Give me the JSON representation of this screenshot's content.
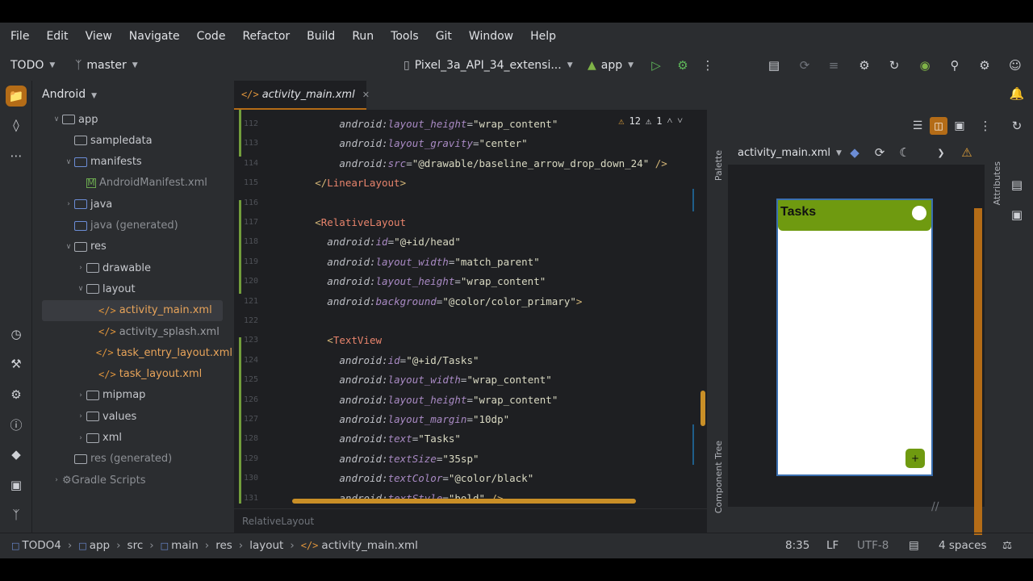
{
  "menu": [
    "File",
    "Edit",
    "View",
    "Navigate",
    "Code",
    "Refactor",
    "Build",
    "Run",
    "Tools",
    "Git",
    "Window",
    "Help"
  ],
  "toolbar": {
    "project": "TODO",
    "branch": "master",
    "device": "Pixel_3a_API_34_extensi...",
    "run_config": "app"
  },
  "project_panel": {
    "view": "Android",
    "items": [
      {
        "label": "app",
        "indent": 1,
        "arrow": "down",
        "icon": "folder"
      },
      {
        "label": "sampledata",
        "indent": 2,
        "arrow": "",
        "icon": "folder"
      },
      {
        "label": "manifests",
        "indent": 2,
        "arrow": "down",
        "icon": "folder-blue"
      },
      {
        "label": "AndroidManifest.xml",
        "indent": 3,
        "arrow": "",
        "icon": "manifest"
      },
      {
        "label": "java",
        "indent": 2,
        "arrow": "right",
        "icon": "folder-blue"
      },
      {
        "label": "java (generated)",
        "indent": 2,
        "arrow": "",
        "icon": "folder-blue"
      },
      {
        "label": "res",
        "indent": 2,
        "arrow": "down",
        "icon": "folder"
      },
      {
        "label": "drawable",
        "indent": 3,
        "arrow": "right",
        "icon": "folder"
      },
      {
        "label": "layout",
        "indent": 3,
        "arrow": "down",
        "icon": "folder"
      },
      {
        "label": "activity_main.xml",
        "indent": 4,
        "arrow": "",
        "icon": "xml",
        "selected": true
      },
      {
        "label": "activity_splash.xml",
        "indent": 4,
        "arrow": "",
        "icon": "xml"
      },
      {
        "label": "task_entry_layout.xml",
        "indent": 4,
        "arrow": "",
        "icon": "xml"
      },
      {
        "label": "task_layout.xml",
        "indent": 4,
        "arrow": "",
        "icon": "xml"
      },
      {
        "label": "mipmap",
        "indent": 3,
        "arrow": "right",
        "icon": "folder"
      },
      {
        "label": "values",
        "indent": 3,
        "arrow": "right",
        "icon": "folder"
      },
      {
        "label": "xml",
        "indent": 3,
        "arrow": "right",
        "icon": "folder"
      },
      {
        "label": "res (generated)",
        "indent": 2,
        "arrow": "",
        "icon": "folder"
      },
      {
        "label": "Gradle Scripts",
        "indent": 1,
        "arrow": "right",
        "icon": "gradle"
      }
    ]
  },
  "editor": {
    "tab": "activity_main.xml",
    "inspections": {
      "warnings": "12",
      "weak": "1"
    },
    "lines": [
      {
        "n": "112",
        "i": 8,
        "kind": "attr",
        "ns": "android",
        "name": "layout_height",
        "value": "\"wrap_content\""
      },
      {
        "n": "113",
        "i": 8,
        "kind": "attr",
        "ns": "android",
        "name": "layout_gravity",
        "value": "\"center\""
      },
      {
        "n": "114",
        "i": 8,
        "kind": "attr",
        "ns": "android",
        "name": "src",
        "value": "\"@drawable/baseline_arrow_drop_down_24\"",
        "tail": " />"
      },
      {
        "n": "115",
        "i": 4,
        "kind": "close",
        "tag": "LinearLayout"
      },
      {
        "n": "116",
        "i": 0,
        "kind": "blank"
      },
      {
        "n": "117",
        "i": 4,
        "kind": "open",
        "tag": "RelativeLayout"
      },
      {
        "n": "118",
        "i": 6,
        "kind": "attr",
        "ns": "android",
        "name": "id",
        "value": "\"@+id/head\""
      },
      {
        "n": "119",
        "i": 6,
        "kind": "attr",
        "ns": "android",
        "name": "layout_width",
        "value": "\"match_parent\""
      },
      {
        "n": "120",
        "i": 6,
        "kind": "attr",
        "ns": "android",
        "name": "layout_height",
        "value": "\"wrap_content\""
      },
      {
        "n": "121",
        "i": 6,
        "kind": "attr",
        "ns": "android",
        "name": "background",
        "value": "\"@color/color_primary\"",
        "tail": ">"
      },
      {
        "n": "122",
        "i": 0,
        "kind": "blank"
      },
      {
        "n": "123",
        "i": 6,
        "kind": "open",
        "tag": "TextView"
      },
      {
        "n": "124",
        "i": 8,
        "kind": "attr",
        "ns": "android",
        "name": "id",
        "value": "\"@+id/Tasks\""
      },
      {
        "n": "125",
        "i": 8,
        "kind": "attr",
        "ns": "android",
        "name": "layout_width",
        "value": "\"wrap_content\""
      },
      {
        "n": "126",
        "i": 8,
        "kind": "attr",
        "ns": "android",
        "name": "layout_height",
        "value": "\"wrap_content\""
      },
      {
        "n": "127",
        "i": 8,
        "kind": "attr",
        "ns": "android",
        "name": "layout_margin",
        "value": "\"10dp\""
      },
      {
        "n": "128",
        "i": 8,
        "kind": "attr",
        "ns": "android",
        "name": "text",
        "value": "\"Tasks\""
      },
      {
        "n": "129",
        "i": 8,
        "kind": "attr",
        "ns": "android",
        "name": "textSize",
        "value": "\"35sp\""
      },
      {
        "n": "130",
        "i": 8,
        "kind": "attr",
        "ns": "android",
        "name": "textColor",
        "value": "\"@color/black\""
      },
      {
        "n": "131",
        "i": 8,
        "kind": "attr",
        "ns": "android",
        "name": "textStyle",
        "value": "\"bold\"",
        "tail": " />"
      }
    ],
    "breadcrumb": "RelativeLayout"
  },
  "design": {
    "file": "activity_main.xml",
    "palette": "Palette",
    "component_tree": "Component Tree",
    "attributes": "Attributes",
    "preview_title": "Tasks",
    "fab": "+"
  },
  "status": {
    "path": [
      "TODO4",
      "app",
      "src",
      "main",
      "res",
      "layout",
      "activity_main.xml"
    ],
    "position": "8:35",
    "line_sep": "LF",
    "encoding": "UTF-8",
    "indent": "4 spaces"
  },
  "colors": {
    "accent": "#b46c17",
    "preview_primary": "#6f9a10",
    "bg": "#2b2d30",
    "editor_bg": "#1e1f22"
  }
}
